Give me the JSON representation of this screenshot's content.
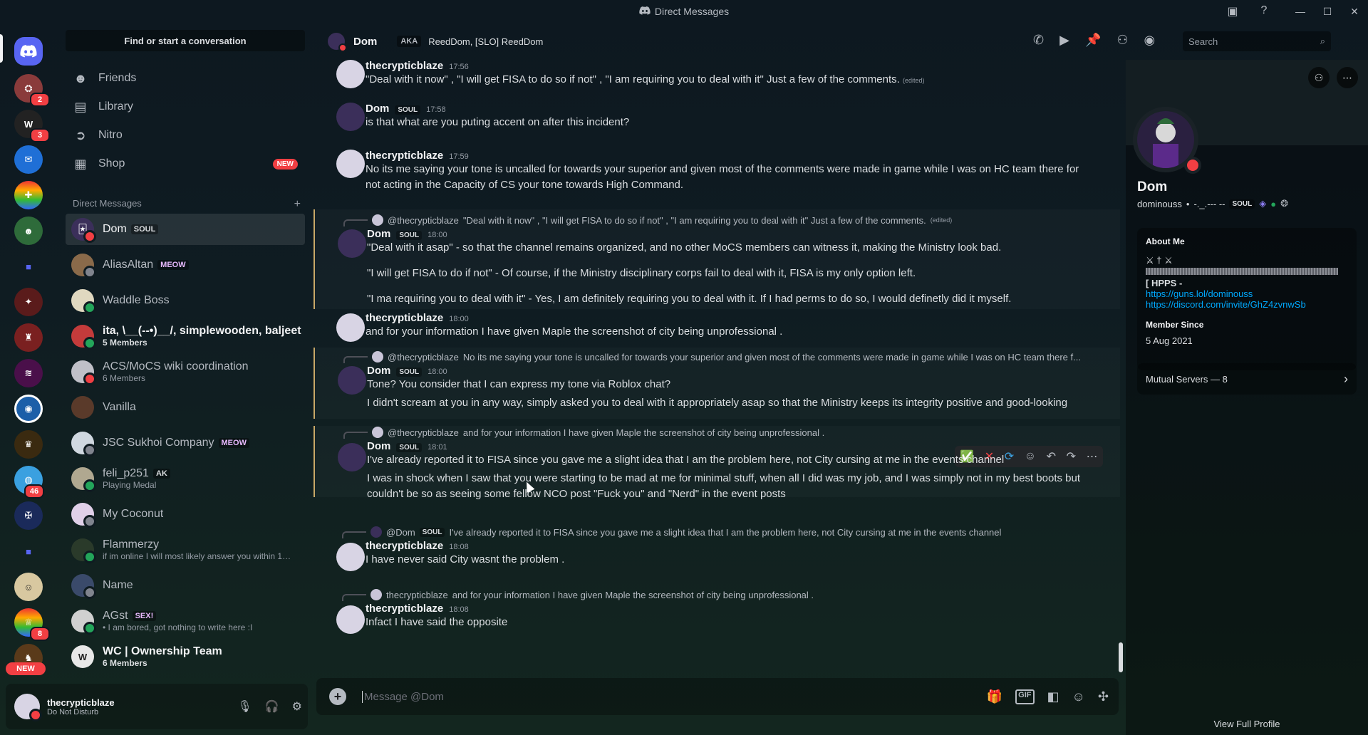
{
  "window": {
    "title": "Direct Messages"
  },
  "sidebar": {
    "search_placeholder": "Find or start a conversation",
    "nav": [
      {
        "label": "Friends",
        "icon": "friends-icon"
      },
      {
        "label": "Library",
        "icon": "library-icon"
      },
      {
        "label": "Nitro",
        "icon": "nitro-icon"
      },
      {
        "label": "Shop",
        "icon": "shop-icon",
        "badge": "NEW"
      }
    ],
    "dm_header": "Direct Messages",
    "dms": [
      {
        "name": "Dom",
        "tag": "SOUL",
        "sub": ""
      },
      {
        "name": "AliasAltan",
        "tag": "MEOW",
        "sub": ""
      },
      {
        "name": "Waddle Boss",
        "tag": "",
        "sub": ""
      },
      {
        "name": "ita, \\__(--•)__/, simplewooden, baljeet",
        "tag": "",
        "sub": "5 Members"
      },
      {
        "name": "ACS/MoCS wiki coordination",
        "tag": "",
        "sub": "6 Members"
      },
      {
        "name": "Vanilla",
        "tag": "",
        "sub": ""
      },
      {
        "name": "JSC Sukhoi Company",
        "tag": "MEOW",
        "sub": ""
      },
      {
        "name": "feli_p251",
        "tag": "AK",
        "sub": "Playing Medal"
      },
      {
        "name": "My Coconut",
        "tag": "",
        "sub": ""
      },
      {
        "name": "Flammerzy",
        "tag": "",
        "sub": "if im online I will most likely answer you within 10 ..."
      },
      {
        "name": "Name",
        "tag": "",
        "sub": ""
      },
      {
        "name": "AGst",
        "tag": "SEX!",
        "sub": "• I am bored, got nothing to write here :I"
      },
      {
        "name": "WC | Ownership Team",
        "tag": "",
        "sub": "6 Members"
      }
    ]
  },
  "rail": {
    "badges": [
      "2",
      "3",
      "46",
      "8"
    ],
    "new_label": "NEW"
  },
  "user": {
    "name": "thecrypticblaze",
    "status": "Do Not Disturb"
  },
  "chat": {
    "name": "Dom",
    "aka_label": "AKA",
    "aka_names": "ReedDom, [SLO] ReedDom",
    "search_placeholder": "Search",
    "composer_placeholder": "Message @Dom"
  },
  "messages": [
    {
      "author": "thecrypticblaze",
      "time": "17:56",
      "text": "\"Deal with it now\" , \"I will get FISA to do so if not\" , \"I am requiring you to deal with it\" Just a few of the comments.",
      "edited": "(edited)"
    },
    {
      "author": "Dom",
      "tag": "SOUL",
      "time": "17:58",
      "text": "is that what are you puting accent on after this incident?"
    },
    {
      "author": "thecrypticblaze",
      "time": "17:59",
      "text": "No its me saying your tone is uncalled for towards your superior and given most of the comments were made in game while I was on HC team there for not acting in the Capacity of CS your tone towards High Command."
    },
    {
      "reply_name": "@thecrypticblaze",
      "reply_text": "\"Deal with it now\" , \"I will get FISA to do so if not\" , \"I am requiring you to deal with it\" Just a few of the comments.",
      "reply_edited": "(edited)",
      "author": "Dom",
      "tag": "SOUL",
      "time": "18:00",
      "text": "\"Deal with it asap\" - so that the channel remains organized, and no other MoCS members can witness it, making the Ministry look bad.",
      "text2": "\"I will get FISA to do if not\" - Of course, if the Ministry disciplinary corps fail to deal with it, FISA is my only option left.",
      "text3": "\"I ma requiring you to deal with it\" - Yes, I am definitely requiring you to deal with it. If I had perms to do so, I would definetly did it myself."
    },
    {
      "author": "thecrypticblaze",
      "time": "18:00",
      "text": "and for your information I have given Maple the screenshot of city being unprofessional ."
    },
    {
      "reply_name": "@thecrypticblaze",
      "reply_text": "No its me saying your tone is uncalled for towards your superior and given most of the comments were made in game while I was on HC team there f...",
      "author": "Dom",
      "tag": "SOUL",
      "time": "18:00",
      "text": "Tone? You consider that I can express my tone via Roblox chat?",
      "text2": "I didn't scream at you in any way, simply asked you to deal with it appropriately asap so that the Ministry keeps its integrity positive and good-looking"
    },
    {
      "reply_name": "@thecrypticblaze",
      "reply_text": "and for your information I have given Maple the screenshot of city being unprofessional .",
      "author": "Dom",
      "tag": "SOUL",
      "time": "18:01",
      "text": "I've already reported it to FISA since you gave me a slight idea that I am the problem here, not City cursing at me in the events channel",
      "text2": "I was in shock when I saw that you were starting to be mad at me for minimal stuff, when all I did was my job, and I was simply not in my best boots but couldn't be so as seeing some fellow NCO post \"Fuck you\" and \"Nerd\" in the event posts"
    },
    {
      "reply_name": "@Dom",
      "reply_tag": "SOUL",
      "reply_text": "I've already reported it to FISA since you gave me a slight idea that I am the problem here, not City cursing at me in the events channel",
      "author": "thecrypticblaze",
      "time": "18:08",
      "text": "I have never said City wasnt the problem ."
    },
    {
      "reply_name": "thecrypticblaze",
      "reply_text": "and for your information I have given Maple the screenshot of city being unprofessional .",
      "author": "thecrypticblaze",
      "time": "18:08",
      "text": "Infact I have said the opposite"
    }
  ],
  "profile": {
    "name": "Dom",
    "username": "dominouss",
    "dot": "•",
    "pronouns": "-._.--- --",
    "tag": "SOUL",
    "about_title": "About Me",
    "about_line1": "⚔ † ⚔",
    "about_line2": "[ HPPS -",
    "link1": "https://guns.lol/dominouss",
    "link2": "https://discord.com/invite/GhZ4zvnwSb",
    "member_since_title": "Member Since",
    "member_since": "5 Aug 2021",
    "mutual": "Mutual Servers — 8",
    "view_full": "View Full Profile"
  },
  "colors": {
    "accent": "#5865f2",
    "dnd": "#f23f43",
    "online": "#23a55a",
    "link": "#00a8fc"
  }
}
